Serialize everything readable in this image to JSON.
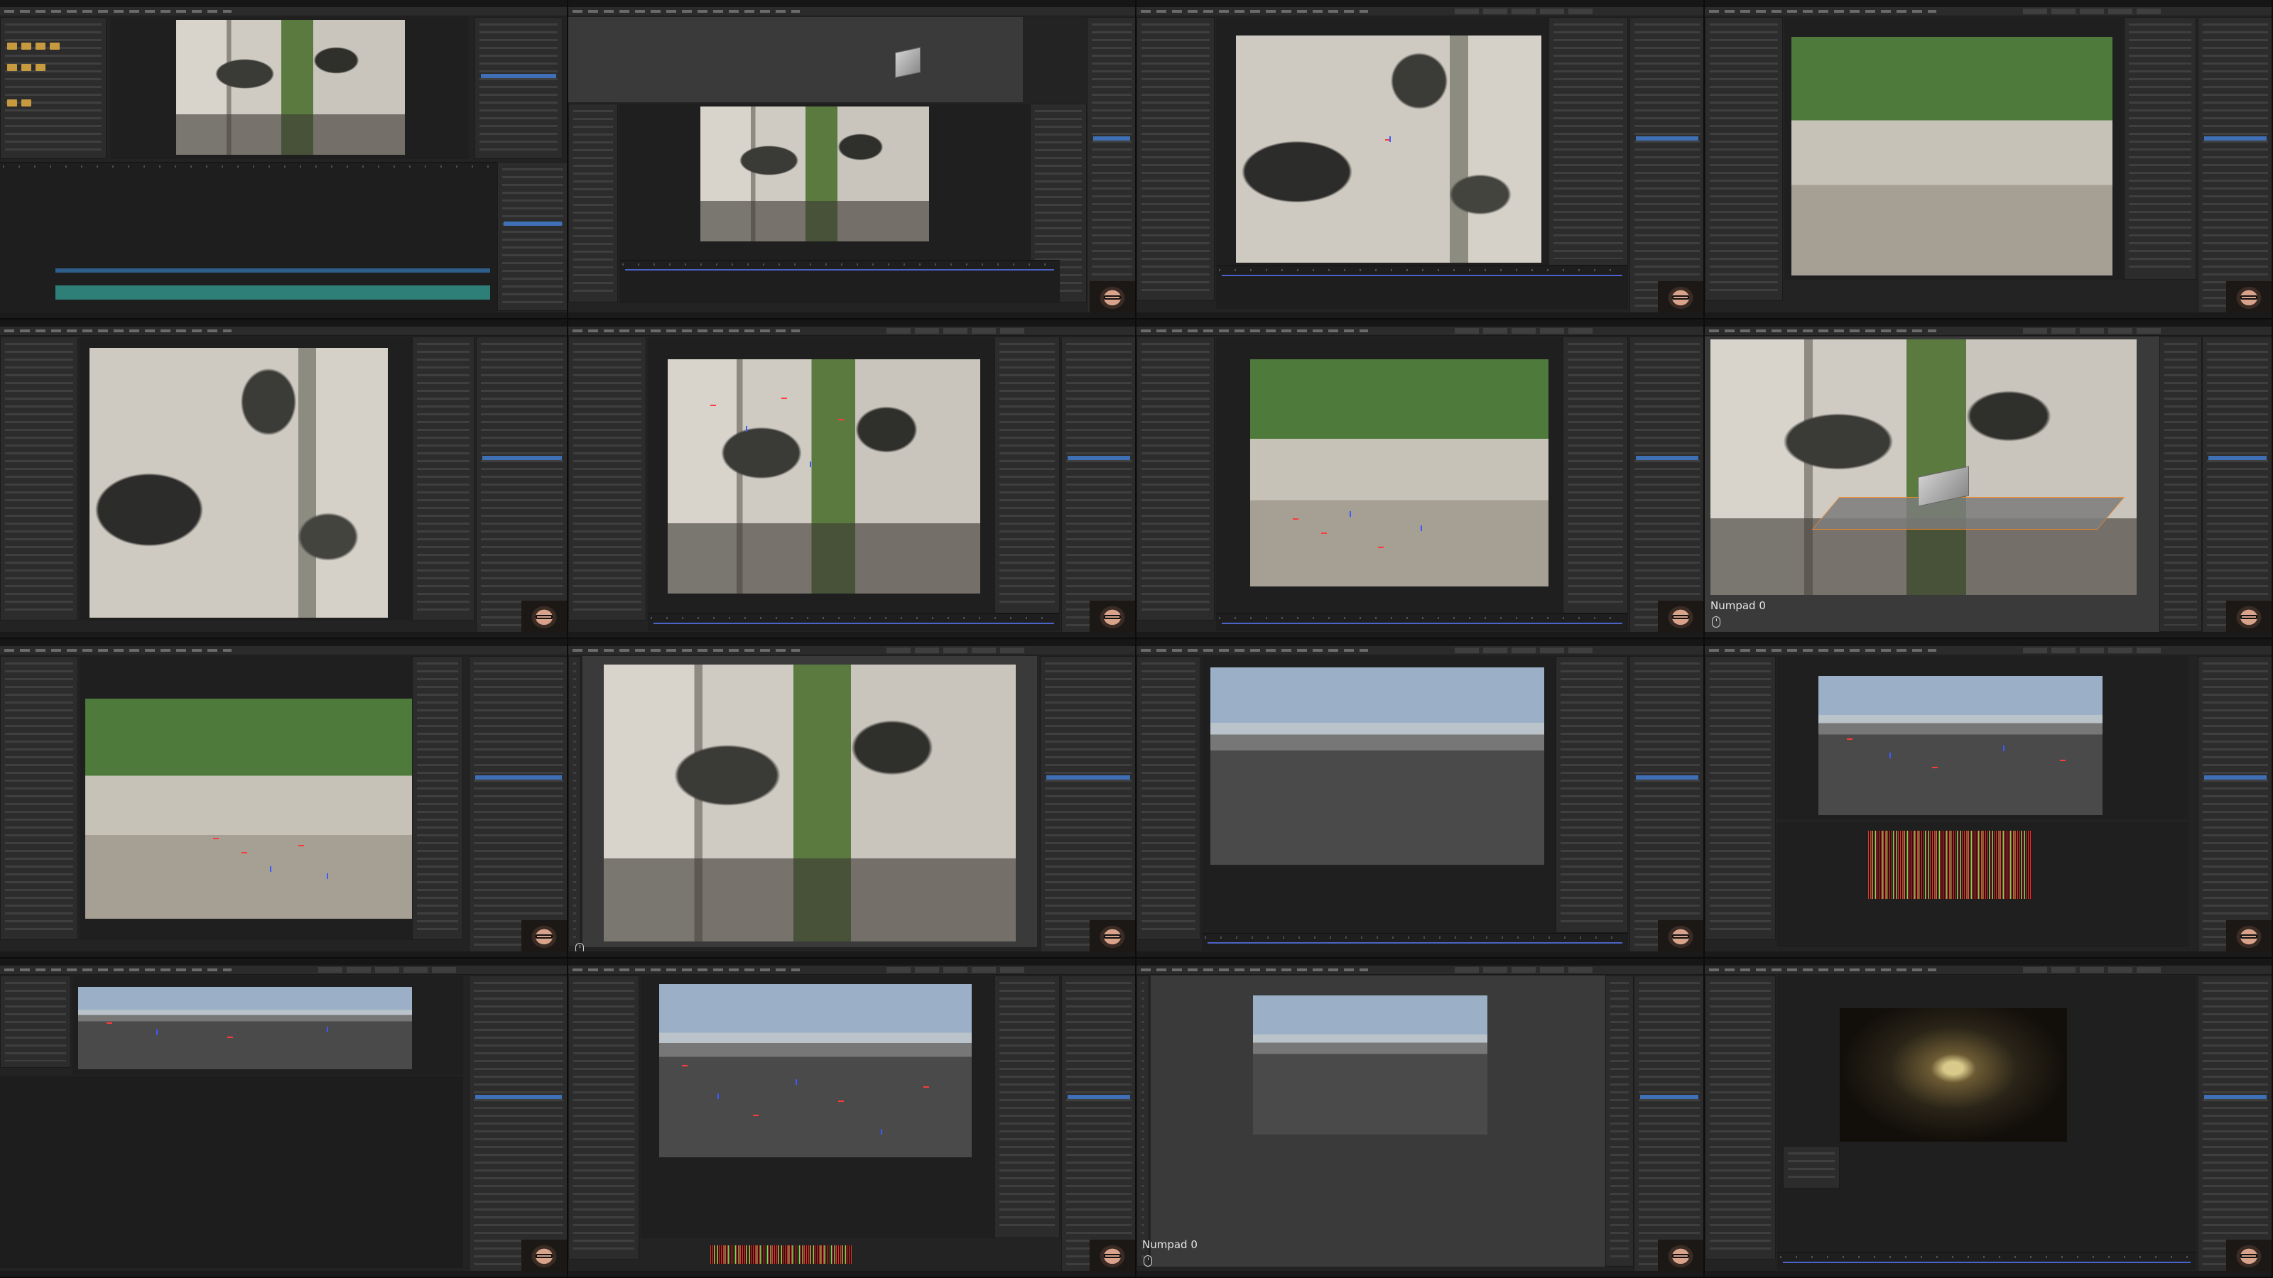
{
  "overlays": {
    "numpad_a": "Numpad 0",
    "numpad_b": "Numpad 0"
  },
  "colors": {
    "accent": "#4b63c7",
    "track_red": "#ff3a3a",
    "track_blue": "#3a5bff",
    "selection_orange": "#ff8a1f"
  },
  "icons": {
    "mouse": "mouse-icon",
    "webcam": "webcam-presenter"
  }
}
